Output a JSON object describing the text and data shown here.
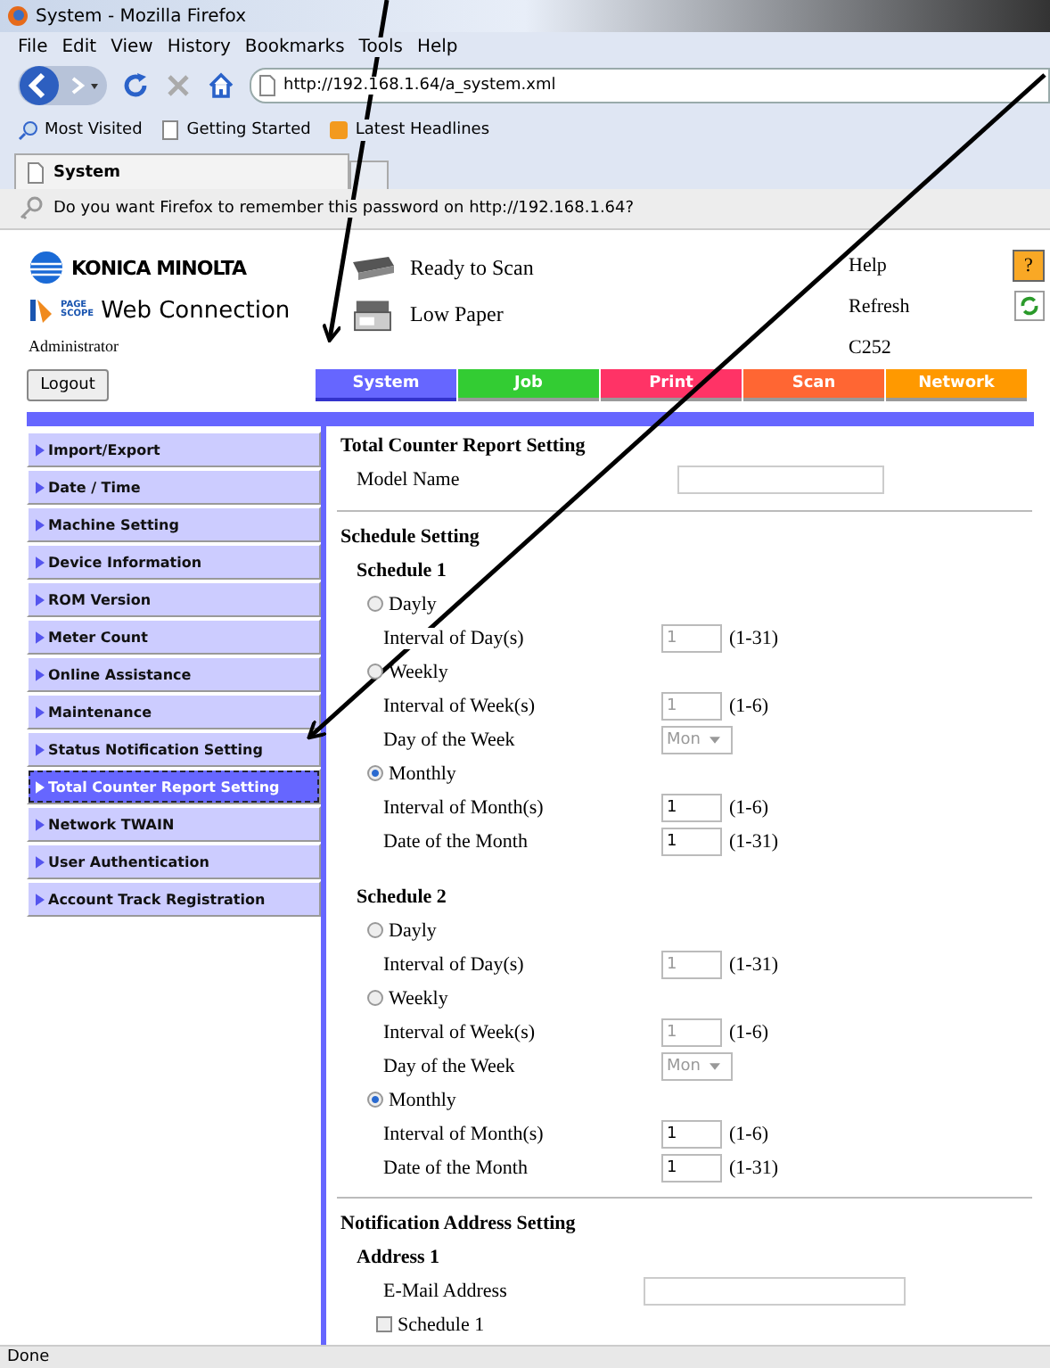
{
  "browser": {
    "title": "System - Mozilla Firefox",
    "menu": [
      "File",
      "Edit",
      "View",
      "History",
      "Bookmarks",
      "Tools",
      "Help"
    ],
    "url": "http://192.168.1.64/a_system.xml",
    "bookmarks": [
      "Most Visited",
      "Getting Started",
      "Latest Headlines"
    ],
    "tab": "System",
    "notification": "Do you want Firefox to remember this password on http://192.168.1.64?",
    "status": "Done"
  },
  "header": {
    "brand": "KONICA MINOLTA",
    "logo_mark": [
      "PAGE",
      "SCOPE"
    ],
    "product": "Web Connection",
    "user": "Administrator",
    "device_status": [
      {
        "kind": "scanner",
        "text": "Ready to Scan"
      },
      {
        "kind": "printer",
        "text": "Low Paper"
      }
    ],
    "help": "Help",
    "help_icon": "?",
    "refresh": "Refresh",
    "model": "C252",
    "logout": "Logout"
  },
  "tabs": [
    {
      "label": "System",
      "color": "#6666ff",
      "selected": true
    },
    {
      "label": "Job",
      "color": "#33cc33",
      "selected": false
    },
    {
      "label": "Print",
      "color": "#ff3366",
      "selected": false
    },
    {
      "label": "Scan",
      "color": "#ff6633",
      "selected": false
    },
    {
      "label": "Network",
      "color": "#ff9900",
      "selected": false
    }
  ],
  "sidebar": {
    "items": [
      {
        "label": "Import/Export",
        "selected": false
      },
      {
        "label": "Date / Time",
        "selected": false
      },
      {
        "label": "Machine Setting",
        "selected": false
      },
      {
        "label": "Device Information",
        "selected": false
      },
      {
        "label": "ROM Version",
        "selected": false
      },
      {
        "label": "Meter Count",
        "selected": false
      },
      {
        "label": "Online Assistance",
        "selected": false
      },
      {
        "label": "Maintenance",
        "selected": false
      },
      {
        "label": "Status Notification Setting",
        "selected": false
      },
      {
        "label": "Total Counter Report Setting",
        "selected": true
      },
      {
        "label": "Network TWAIN",
        "selected": false
      },
      {
        "label": "User Authentication",
        "selected": false
      },
      {
        "label": "Account Track Registration",
        "selected": false
      }
    ]
  },
  "form": [
    {
      "kind": "title",
      "text": "Total Counter Report Setting"
    },
    {
      "kind": "text-field",
      "label": "Model Name"
    },
    {
      "kind": "rule"
    },
    {
      "kind": "section",
      "text": "Schedule Setting"
    },
    {
      "kind": "subsection",
      "text": "Schedule 1"
    },
    {
      "kind": "radio",
      "label": "Dayly",
      "selected": false
    },
    {
      "kind": "number",
      "label": "Interval of Day(s)",
      "value": "1",
      "range": "(1-31)",
      "disabled": true
    },
    {
      "kind": "radio",
      "label": "Weekly",
      "selected": false
    },
    {
      "kind": "number",
      "label": "Interval of Week(s)",
      "value": "1",
      "range": "(1-6)",
      "disabled": true
    },
    {
      "kind": "select",
      "label": "Day of the Week",
      "value": "Mon",
      "disabled": true
    },
    {
      "kind": "radio",
      "label": "Monthly",
      "selected": true
    },
    {
      "kind": "number",
      "label": "Interval of Month(s)",
      "value": "1",
      "range": "(1-6)",
      "disabled": false
    },
    {
      "kind": "number",
      "label": "Date of the Month",
      "value": "1",
      "range": "(1-31)",
      "disabled": false
    },
    {
      "kind": "spacer"
    },
    {
      "kind": "subsection",
      "text": "Schedule 2"
    },
    {
      "kind": "radio",
      "label": "Dayly",
      "selected": false
    },
    {
      "kind": "number",
      "label": "Interval of Day(s)",
      "value": "1",
      "range": "(1-31)",
      "disabled": true
    },
    {
      "kind": "radio",
      "label": "Weekly",
      "selected": false
    },
    {
      "kind": "number",
      "label": "Interval of Week(s)",
      "value": "1",
      "range": "(1-6)",
      "disabled": true
    },
    {
      "kind": "select",
      "label": "Day of the Week",
      "value": "Mon",
      "disabled": true
    },
    {
      "kind": "radio",
      "label": "Monthly",
      "selected": true
    },
    {
      "kind": "number",
      "label": "Interval of Month(s)",
      "value": "1",
      "range": "(1-6)",
      "disabled": false
    },
    {
      "kind": "number",
      "label": "Date of the Month",
      "value": "1",
      "range": "(1-31)",
      "disabled": false
    },
    {
      "kind": "rule"
    },
    {
      "kind": "section",
      "text": "Notification Address Setting"
    },
    {
      "kind": "subsection",
      "text": "Address 1"
    },
    {
      "kind": "text-field",
      "label": "E-Mail Address"
    },
    {
      "kind": "checkbox",
      "label": "Schedule 1",
      "checked": false
    }
  ]
}
